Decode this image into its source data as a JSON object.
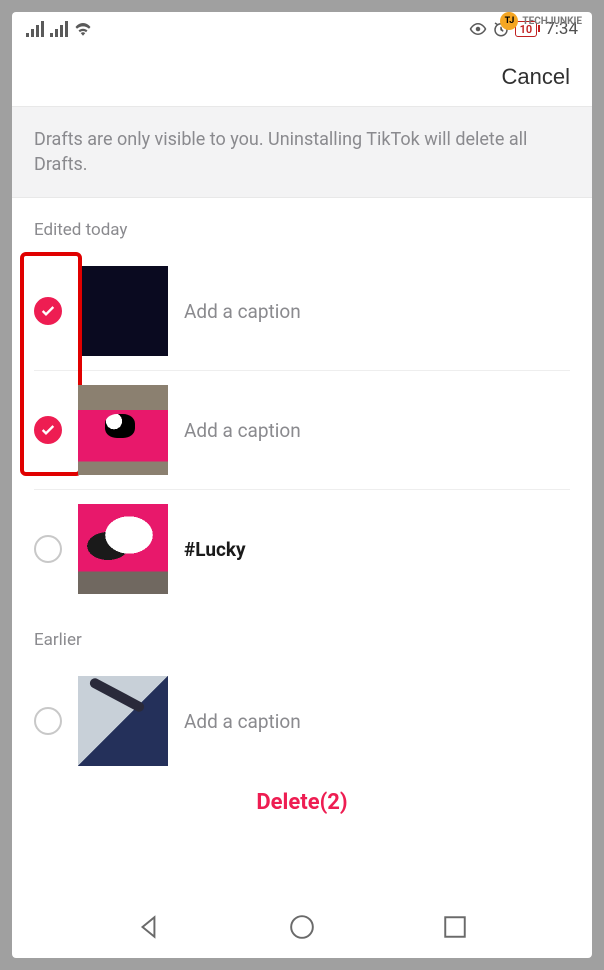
{
  "status_bar": {
    "battery_level": "10",
    "time": "7:34"
  },
  "watermark": {
    "badge": "TJ",
    "text": "TECHJUNKIE"
  },
  "header": {
    "cancel_label": "Cancel"
  },
  "info_banner": "Drafts are only visible to you. Uninstalling TikTok will delete all Drafts.",
  "sections": {
    "today_label": "Edited today",
    "earlier_label": "Earlier"
  },
  "drafts_today": [
    {
      "caption": "Add a caption",
      "selected": true,
      "has_caption": false
    },
    {
      "caption": "Add a caption",
      "selected": true,
      "has_caption": false
    },
    {
      "caption": "#Lucky",
      "selected": false,
      "has_caption": true
    }
  ],
  "drafts_earlier": [
    {
      "caption": "Add a caption",
      "selected": false,
      "has_caption": false
    }
  ],
  "delete_label": "Delete(2)"
}
